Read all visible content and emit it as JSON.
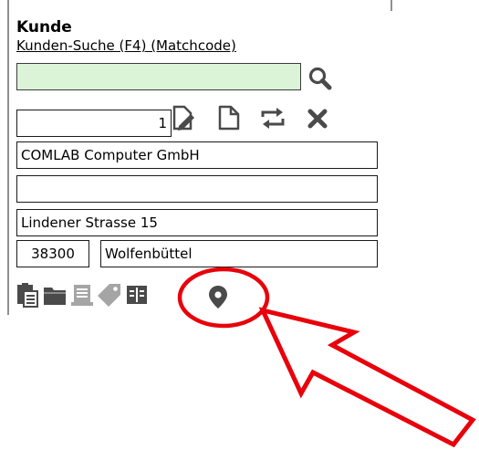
{
  "section": {
    "title": "Kunde",
    "search_link": "Kunden-Suche (F4) (Matchcode)",
    "search_value": "",
    "search_placeholder": ""
  },
  "record": {
    "number": "1",
    "name1": "COMLAB Computer GmbH",
    "name2": "",
    "street": "Lindener Strasse 15",
    "zip": "38300",
    "city": "Wolfenbüttel"
  },
  "icons": {
    "search": "magnifier-icon",
    "record_actions": [
      "edit-document-icon",
      "new-document-icon",
      "transfer-icon",
      "delete-icon"
    ],
    "bottom_bar": [
      "clipboard-icon",
      "folder-icon",
      "document-list-icon",
      "tag-icon",
      "address-book-icon",
      "map-pin-icon"
    ]
  },
  "colors": {
    "search_field_background": "#dbf4d7",
    "icon_color": "#4a4a4a",
    "annotation_red": "#e8000b"
  }
}
